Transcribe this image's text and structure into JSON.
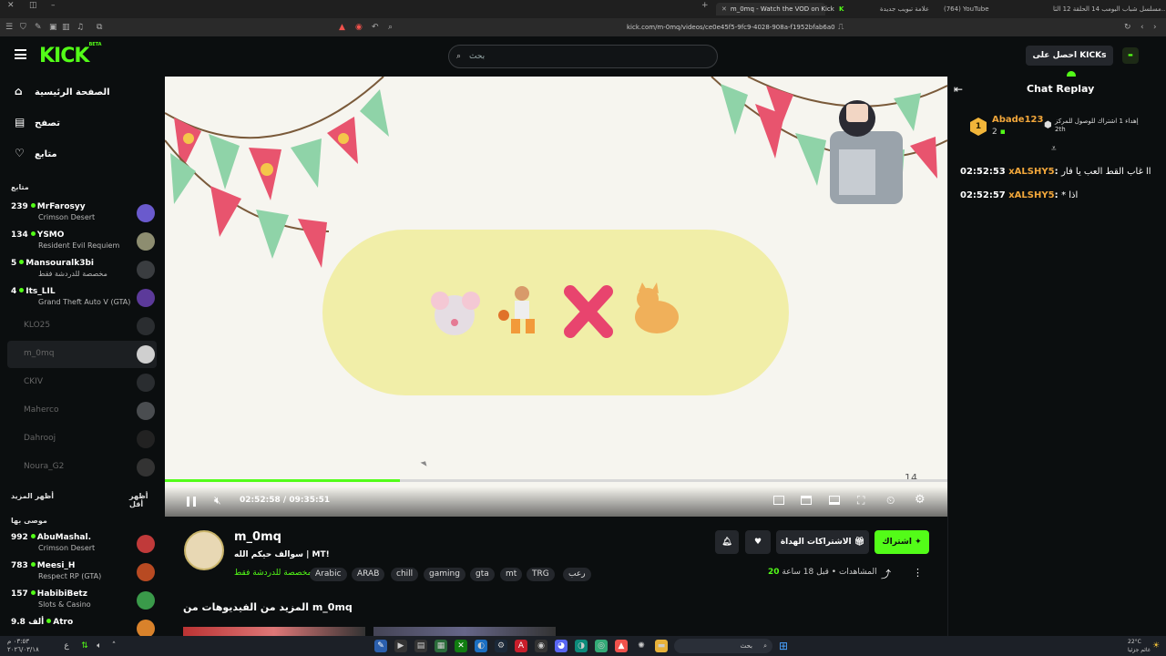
{
  "browser": {
    "tabs": [
      {
        "label": "m_0mq - Watch the VOD on Kick",
        "active": true
      },
      {
        "label": "علامة تبويب جديدة",
        "active": false
      },
      {
        "label": "(764) YouTube",
        "active": false
      },
      {
        "label": "مسلسل شباب البومب 14 الحلقة 12 الثا...",
        "active": false
      }
    ],
    "url": "kick.com/m-0mq/videos/ce0e45f5-9fc9-4028-908a-f1952bfab6a0"
  },
  "header": {
    "logo": "KICK",
    "logo_badge": "BETA",
    "search_placeholder": "بحث",
    "kicks_button": "احصل على KICKs"
  },
  "sidebar": {
    "nav": [
      {
        "label": "الصفحة الرئيسية",
        "icon": "home-icon"
      },
      {
        "label": "تصفح",
        "icon": "browse-icon"
      },
      {
        "label": "متابع",
        "icon": "heart-icon"
      }
    ],
    "following_heading": "متابع",
    "following": [
      {
        "count": "239",
        "name": "MrFarosyy",
        "sub": "Crimson Desert",
        "live": true
      },
      {
        "count": "134",
        "name": "YSMO",
        "sub": "Resident Evil Requiem",
        "live": true
      },
      {
        "count": "5",
        "name": "Mansouralk3bi",
        "sub": "مخصصة للدردشة فقط",
        "live": true
      },
      {
        "count": "4",
        "name": "Its_LIL",
        "sub": "Grand Theft Auto V (GTA)",
        "live": true
      },
      {
        "count": "",
        "name": "KLO25",
        "sub": "",
        "live": false
      },
      {
        "count": "",
        "name": "m_0mq",
        "sub": "",
        "live": false,
        "selected": true
      },
      {
        "count": "",
        "name": "CKIV",
        "sub": "",
        "live": false
      },
      {
        "count": "",
        "name": "Maherco",
        "sub": "",
        "live": false
      },
      {
        "count": "",
        "name": "Dahrooj",
        "sub": "",
        "live": false
      },
      {
        "count": "",
        "name": "Noura_G2",
        "sub": "",
        "live": false
      }
    ],
    "show_more": "أظهر المزيد",
    "show_less": "أظهر أقل",
    "recommended_heading": "موصى بها",
    "recommended": [
      {
        "count": "992",
        "name": "AbuMashal.",
        "sub": "Crimson Desert",
        "live": true
      },
      {
        "count": "783",
        "name": "Meesi_H",
        "sub": "Respect RP (GTA)",
        "live": true
      },
      {
        "count": "157",
        "name": "HabibiBetz",
        "sub": "Slots & Casino",
        "live": true
      },
      {
        "count": "9.8 ألف",
        "name": "Atro",
        "sub": "",
        "live": true
      }
    ]
  },
  "player": {
    "time_current": "02:52:58",
    "time_total": "09:35:51",
    "time_separator": "/",
    "progress": 0.3,
    "overlay_number": "14"
  },
  "channel": {
    "name": "m_0mq",
    "title": "سوالف حيكم الله | MT!",
    "category": "مخصصة للدردشة فقط",
    "tags": [
      "Arabic",
      "ARAB",
      "chill",
      "gaming",
      "gta",
      "mt",
      "TRG",
      "رعب"
    ],
    "views_count": "20",
    "views_label": "المشاهدات",
    "time_ago": "قبل 18 ساعة",
    "subscribe_button": "اشتراك",
    "gift_button": "الاشتراكات الهداة",
    "more_videos_heading": "المزيد من الفيديوهات من m_0mq"
  },
  "chat": {
    "title": "Chat Replay",
    "pinned_user": "Abade123",
    "pinned_rank": "1",
    "pinned_count": "2",
    "pinned_text": "إهداء 1 اشتراك للوصول للمركز",
    "pinned_place": "2th",
    "messages": [
      {
        "time": "02:52:53",
        "user": "xALSHY5",
        "text": "اا غاب القط العب يا فار"
      },
      {
        "time": "02:52:57",
        "user": "xALSHY5",
        "text": "* اذا"
      }
    ]
  },
  "taskbar": {
    "search_label": "بحث",
    "weather": "22°C",
    "weather_sub": "غائم جزئيا",
    "clock_time": "٠٣:٥٣ م",
    "clock_date": "٢٠٢٦/٠٣/١٨"
  },
  "colors": {
    "accent": "#53fc18",
    "chat_user": "#f2a73b",
    "background": "#0b0e0f"
  }
}
